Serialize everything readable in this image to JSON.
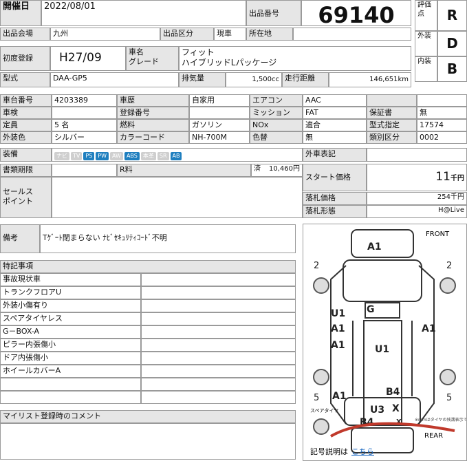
{
  "header": {
    "date_label": "開催日",
    "date": "2022/08/01",
    "lot_label": "出品番号",
    "lot": "69140"
  },
  "grades": [
    {
      "label": "評価点",
      "value": "R"
    },
    {
      "label": "外装",
      "value": "D"
    },
    {
      "label": "内装",
      "value": "B"
    }
  ],
  "row1": {
    "venue_label": "出品会場",
    "venue": "九州",
    "category_label": "出品区分",
    "category": "現車",
    "location_label": "所在地",
    "location": ""
  },
  "row2": {
    "reg_label": "初度登録",
    "reg": "H27/09",
    "car_label": "車名\nグレード",
    "car": "フィット\nハイブリッドLパッケージ"
  },
  "row3": {
    "model_label": "型式",
    "model": "DAA-GP5",
    "disp_label": "排気量",
    "disp": "1,500cc",
    "mileage_label": "走行距離",
    "mileage": "146,651km"
  },
  "specs": [
    [
      "車台番号",
      "4203389",
      "車歴",
      "自家用",
      "エアコン",
      "AAC"
    ],
    [
      "車検",
      "",
      "登録番号",
      "",
      "ミッション",
      "FAT"
    ],
    [
      "定員",
      "5 名",
      "燃料",
      "ガソリン",
      "NOx",
      "適合"
    ],
    [
      "外装色",
      "シルバー",
      "カラーコード",
      "NH-700M",
      "色替",
      "無"
    ]
  ],
  "right_specs": [
    [
      "保証書",
      "無"
    ],
    [
      "型式指定",
      "17574"
    ],
    [
      "類別区分",
      "0002"
    ]
  ],
  "equipment_label": "装備",
  "equipment": [
    {
      "name": "ナビ",
      "on": false
    },
    {
      "name": "TV",
      "on": false
    },
    {
      "name": "PS",
      "on": true
    },
    {
      "name": "PW",
      "on": true
    },
    {
      "name": "AW",
      "on": false
    },
    {
      "name": "ABS",
      "on": true
    },
    {
      "name": "本革",
      "on": false
    },
    {
      "name": "SR",
      "on": false
    },
    {
      "name": "AB",
      "on": true
    }
  ],
  "docs": {
    "label": "書類期限",
    "recycle_label": "R料",
    "recycle_status": "済",
    "recycle_amount": "10,460円"
  },
  "prices": {
    "outer_label": "外車表記",
    "start_label": "スタート価格",
    "start": "11",
    "start_unit": "千円",
    "final_label": "落札価格",
    "final": "254千円",
    "type_label": "落札形態",
    "type": "H@Live"
  },
  "sales_point_label": "セールス\nポイント",
  "remarks": {
    "label": "備考",
    "text": "Tｹﾞｰﾄ閉まらない ﾅﾋﾞｾｷｭﾘﾃｨｺｰﾄﾞ不明"
  },
  "special": {
    "title": "特記事項",
    "items": [
      "事故現状車",
      "トランクフロアU",
      "外装小傷有り",
      "スペアタイヤレス",
      "G－BOX-A",
      "ピラー内張傷小",
      "ドア内張傷小",
      "ホイールカバーA",
      "",
      ""
    ]
  },
  "mylist_label": "マイリスト登録時のコメント",
  "diagram": {
    "front": "FRONT",
    "rear": "REAR",
    "marks": [
      "A1",
      "G",
      "U1",
      "A1",
      "A1",
      "A1",
      "U1",
      "B4",
      "A1",
      "U3",
      "X",
      "X",
      "B4"
    ],
    "tires": [
      "2",
      "2",
      "5",
      "5"
    ],
    "tire_unit": "mm",
    "spare_label": "スペアタイヤ",
    "note": "※mmはタイヤの残溝表示です",
    "legend_label": "記号説明は",
    "legend_link": "こちら"
  }
}
